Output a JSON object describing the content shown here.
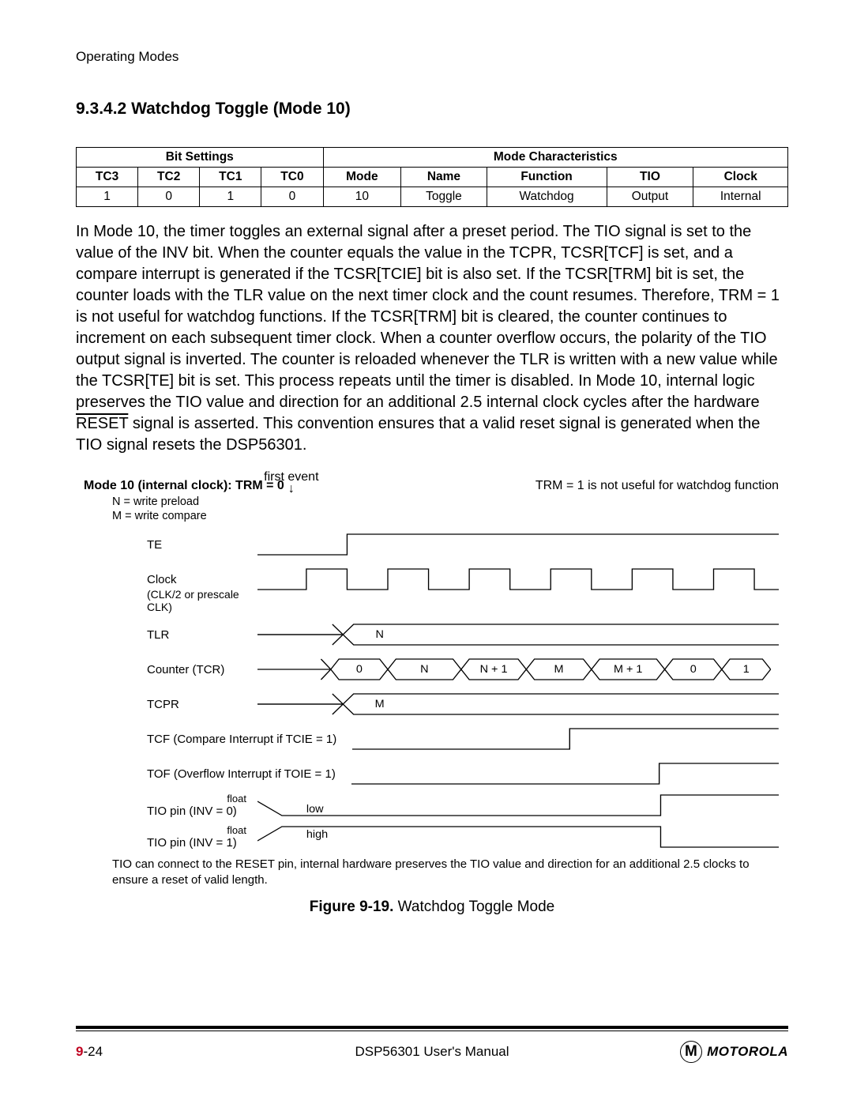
{
  "running_head": "Operating Modes",
  "section_number": "9.3.4.2",
  "section_title": "Watchdog Toggle (Mode 10)",
  "table": {
    "header_groups": {
      "left": "Bit Settings",
      "right": "Mode Characteristics"
    },
    "cols": [
      "TC3",
      "TC2",
      "TC1",
      "TC0",
      "Mode",
      "Name",
      "Function",
      "TIO",
      "Clock"
    ],
    "row": [
      "1",
      "0",
      "1",
      "0",
      "10",
      "Toggle",
      "Watchdog",
      "Output",
      "Internal"
    ]
  },
  "body_html": "In Mode 10, the timer toggles an external signal after a preset period. The TIO signal is set to the value of the INV bit. When the counter equals the value in the TCPR, TCSR[TCF] is set, and a compare interrupt is generated if the TCSR[TCIE] bit is also set. If the TCSR[TRM] bit is set, the counter loads with the TLR value on the next timer clock and the count resumes. Therefore, TRM = 1 is not useful for watchdog functions. If the TCSR[TRM] bit is cleared, the counter continues to increment on each subsequent timer clock. When a counter overflow occurs, the polarity of the TIO output signal is inverted. The counter is reloaded whenever the TLR is written with a new value while the TCSR[TE] bit is set. This process repeats until the timer is disabled. In Mode 10, internal logic preserves the TIO value and direction for an additional 2.5 internal clock cycles after the hardware RESET signal is asserted. This convention ensures that a valid reset signal is generated when the TIO signal resets the DSP56301.",
  "diagram": {
    "title_bold": "Mode 10 (internal clock): TRM = 0",
    "first_event": "first event",
    "trm_note": "TRM = 1 is not useful for watchdog function",
    "n_def": "N = write preload",
    "m_def": "M = write compare",
    "labels": {
      "te": "TE",
      "clock": "Clock",
      "clock_sub": "(CLK/2 or prescale CLK)",
      "tlr": "TLR",
      "tlr_val": "N",
      "counter": "Counter (TCR)",
      "counter_vals": [
        "0",
        "N",
        "N + 1",
        "M",
        "M + 1",
        "0",
        "1"
      ],
      "tcpr": "TCPR",
      "tcpr_val": "M",
      "tcf": "TCF (Compare Interrupt if TCIE = 1)",
      "tof": "TOF (Overflow Interrupt if TOIE = 1)",
      "tio0": "TIO pin (INV = 0)",
      "tio1": "TIO pin (INV = 1)",
      "float": "float",
      "low": "low",
      "high": "high"
    },
    "note": "TIO can connect to the RESET pin, internal hardware preserves the TIO value and direction for an additional 2.5 clocks to ensure a reset of valid length."
  },
  "figure_caption": {
    "label": "Figure 9-19.",
    "text": " Watchdog Toggle Mode"
  },
  "footer": {
    "page_chapter": "9",
    "page_num": "-24",
    "center": "DSP56301 User's Manual",
    "brand": "MOTOROLA",
    "logo_letter": "M"
  }
}
